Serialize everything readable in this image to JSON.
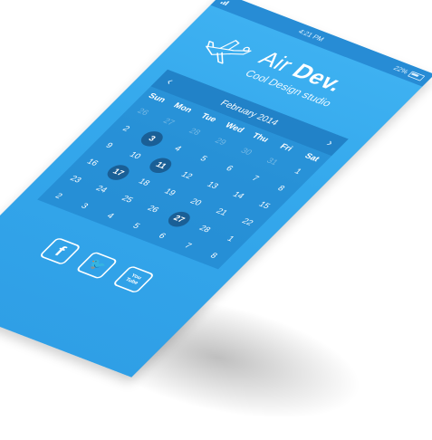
{
  "status_bar": {
    "time": "4:21 PM",
    "battery": "22%"
  },
  "brand": {
    "name_light": "Air ",
    "name_bold": "Dev.",
    "tagline": "Cool Design studio",
    "logo_icon": "airplane-icon"
  },
  "calendar": {
    "month": "February 2014",
    "prev_icon": "chevron-left-icon",
    "next_icon": "chevron-right-icon",
    "weekdays": [
      "Sun",
      "Mon",
      "Tue",
      "Wed",
      "Thu",
      "Fri",
      "Sat"
    ],
    "weeks": [
      [
        {
          "d": "26",
          "m": true
        },
        {
          "d": "27",
          "m": true
        },
        {
          "d": "28",
          "m": true
        },
        {
          "d": "29",
          "m": true
        },
        {
          "d": "30",
          "m": true
        },
        {
          "d": "31",
          "m": true
        },
        {
          "d": "1"
        }
      ],
      [
        {
          "d": "2"
        },
        {
          "d": "3",
          "h": true
        },
        {
          "d": "4"
        },
        {
          "d": "5"
        },
        {
          "d": "6"
        },
        {
          "d": "7"
        },
        {
          "d": "8"
        }
      ],
      [
        {
          "d": "9"
        },
        {
          "d": "10"
        },
        {
          "d": "11",
          "h": true
        },
        {
          "d": "12"
        },
        {
          "d": "13"
        },
        {
          "d": "14"
        },
        {
          "d": "15"
        }
      ],
      [
        {
          "d": "16"
        },
        {
          "d": "17",
          "h": true
        },
        {
          "d": "18"
        },
        {
          "d": "19"
        },
        {
          "d": "20"
        },
        {
          "d": "21"
        },
        {
          "d": "22"
        }
      ],
      [
        {
          "d": "23"
        },
        {
          "d": "24"
        },
        {
          "d": "25"
        },
        {
          "d": "26"
        },
        {
          "d": "27",
          "h": true
        },
        {
          "d": "28"
        },
        {
          "d": "1"
        }
      ],
      [
        {
          "d": "2"
        },
        {
          "d": "3"
        },
        {
          "d": "4"
        },
        {
          "d": "5"
        },
        {
          "d": "6"
        },
        {
          "d": "7"
        },
        {
          "d": "8"
        }
      ]
    ]
  },
  "social": [
    {
      "label": "f",
      "icon": "facebook-icon"
    },
    {
      "label": "🐦",
      "icon": "twitter-icon"
    },
    {
      "label": "You\nTube",
      "icon": "youtube-icon"
    }
  ],
  "colors": {
    "screen_bg": "#34a8ec",
    "marked_day": "#1a5f96"
  }
}
